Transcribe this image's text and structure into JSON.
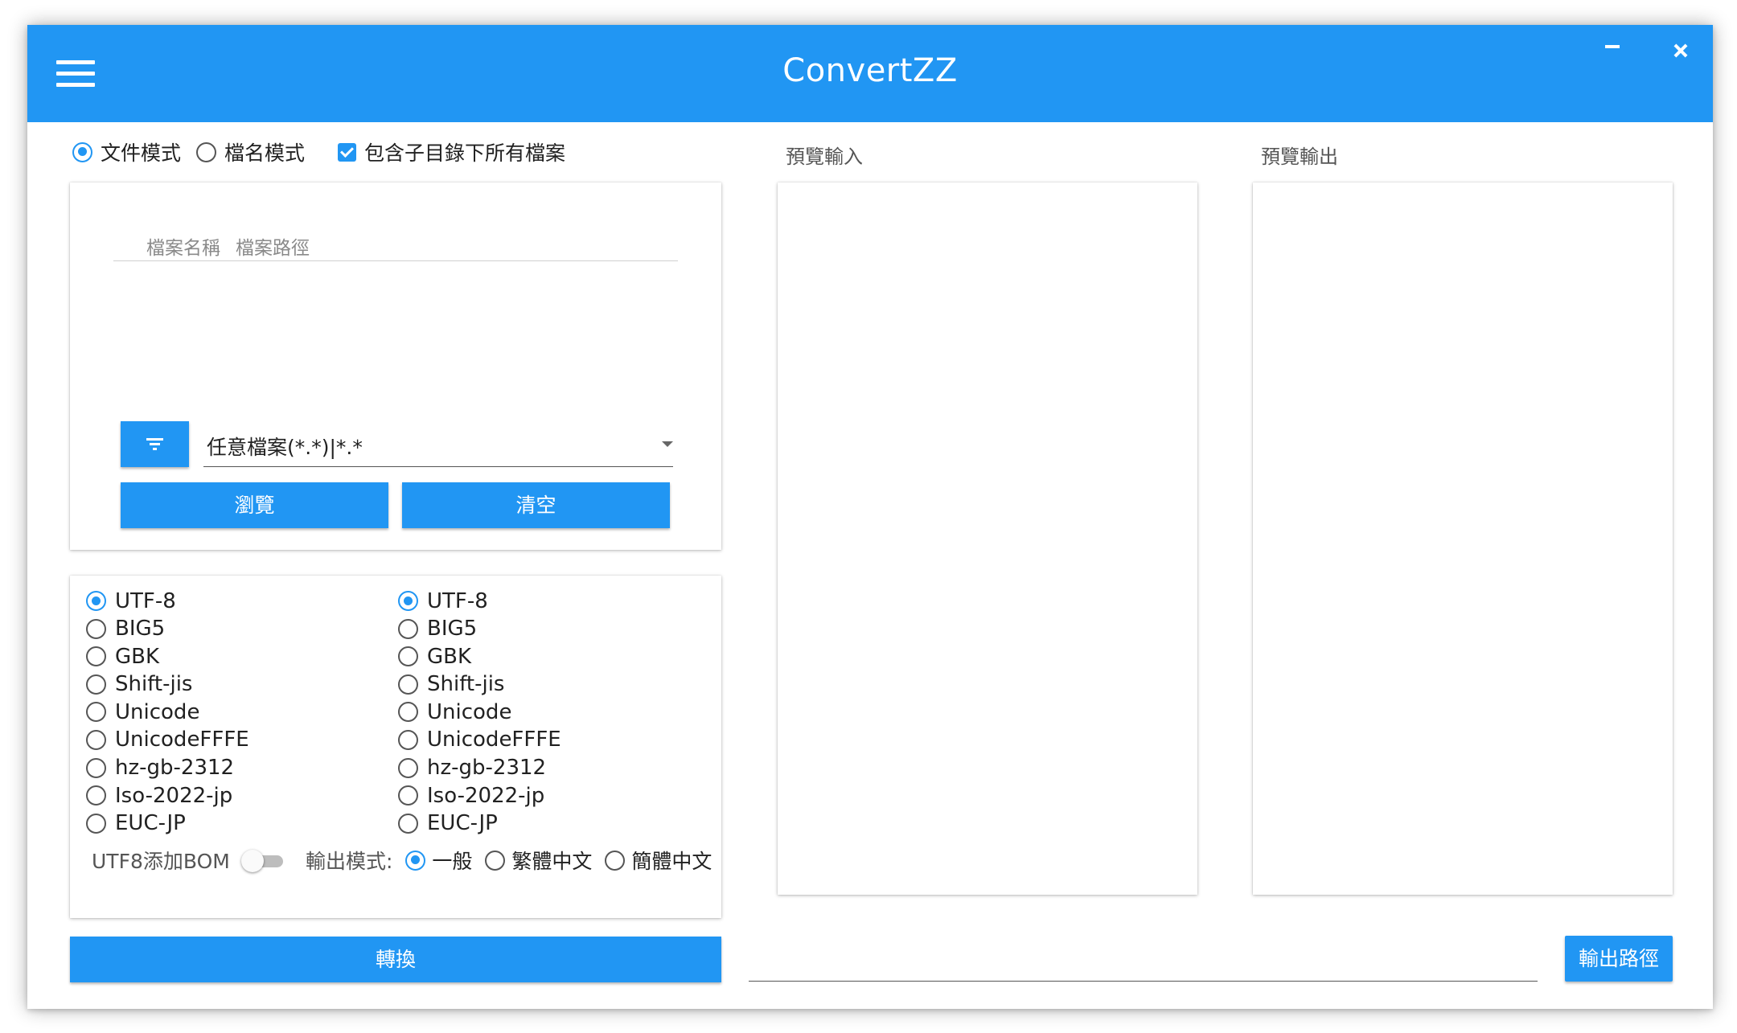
{
  "app": {
    "title": "ConvertZZ"
  },
  "mode": {
    "options": [
      {
        "label": "文件模式",
        "checked": true
      },
      {
        "label": "檔名模式",
        "checked": false
      }
    ],
    "include_subdirs": {
      "label": "包含子目錄下所有檔案",
      "checked": true
    }
  },
  "file_list": {
    "columns": [
      "檔案名稱",
      "檔案路徑"
    ],
    "rows": []
  },
  "filter": {
    "selected": "任意檔案(*.*)|*.*"
  },
  "buttons": {
    "browse": "瀏覽",
    "clear": "清空",
    "convert": "轉換",
    "output_path": "輸出路徑"
  },
  "encoding": {
    "input": [
      {
        "label": "UTF-8",
        "checked": true
      },
      {
        "label": "BIG5",
        "checked": false
      },
      {
        "label": "GBK",
        "checked": false
      },
      {
        "label": "Shift-jis",
        "checked": false
      },
      {
        "label": "Unicode",
        "checked": false
      },
      {
        "label": "UnicodeFFFE",
        "checked": false
      },
      {
        "label": "hz-gb-2312",
        "checked": false
      },
      {
        "label": "Iso-2022-jp",
        "checked": false
      },
      {
        "label": "EUC-JP",
        "checked": false
      }
    ],
    "output": [
      {
        "label": "UTF-8",
        "checked": true
      },
      {
        "label": "BIG5",
        "checked": false
      },
      {
        "label": "GBK",
        "checked": false
      },
      {
        "label": "Shift-jis",
        "checked": false
      },
      {
        "label": "Unicode",
        "checked": false
      },
      {
        "label": "UnicodeFFFE",
        "checked": false
      },
      {
        "label": "hz-gb-2312",
        "checked": false
      },
      {
        "label": "Iso-2022-jp",
        "checked": false
      },
      {
        "label": "EUC-JP",
        "checked": false
      }
    ],
    "bom": {
      "label": "UTF8添加BOM",
      "on": false
    },
    "output_mode": {
      "title": "輸出模式:",
      "options": [
        {
          "label": "一般",
          "checked": true
        },
        {
          "label": "繁體中文",
          "checked": false
        },
        {
          "label": "簡體中文",
          "checked": false
        }
      ]
    }
  },
  "preview": {
    "input_label": "預覽輸入",
    "output_label": "預覽輸出",
    "input_text": "",
    "output_text": ""
  },
  "output_path": {
    "value": ""
  },
  "colors": {
    "accent": "#2196F3"
  }
}
